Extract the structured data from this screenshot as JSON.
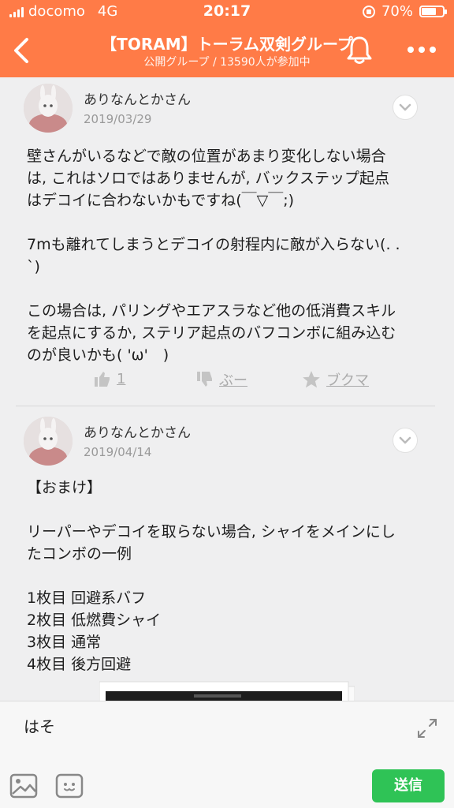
{
  "status_bar": {
    "carrier": "docomo",
    "network": "4G",
    "time": "20:17",
    "battery": "70%",
    "battery_level": 0.7
  },
  "header": {
    "title": "【TORAM】トーラム双剣グループ",
    "subtitle": "公開グループ / 13590人が参加中",
    "back_icon": "chevron-left-icon",
    "bell_icon": "bell-icon",
    "more_icon": "more-dots-icon"
  },
  "posts": [
    {
      "author": "ありなんとかさん",
      "date": "2019/03/29",
      "paragraphs": [
        "壁さんがいるなどで敵の位置があまり変化しない場合\nは, これはソロではありませんが, バックステップ起点\nはデコイに合わないかもですね(￣▽￣;)",
        "7mも離れてしまうとデコイの射程内に敵が入らない(. .\n`)",
        "この場合は, パリングやエアスラなど他の低消費スキル\nを起点にするか, ステリア起点のバフコンボに組み込む\nのが良いかも( 'ω'　)"
      ],
      "like_count": "1",
      "boo_label": "ぶー",
      "bookmark_label": "ブクマ"
    },
    {
      "author": "ありなんとかさん",
      "date": "2019/04/14",
      "paragraphs": [
        "【おまけ】",
        "リーパーやデコイを取らない場合, シャイをメインにし\nたコンボの一例",
        "1枚目 回避系バフ\n2枚目 低燃費シャイ\n3枚目 通常\n4枚目 後方回避"
      ]
    }
  ],
  "composer": {
    "text": "はそ",
    "send_label": "送信"
  },
  "colors": {
    "brand": "#ff7b47",
    "send": "#2fc356"
  }
}
